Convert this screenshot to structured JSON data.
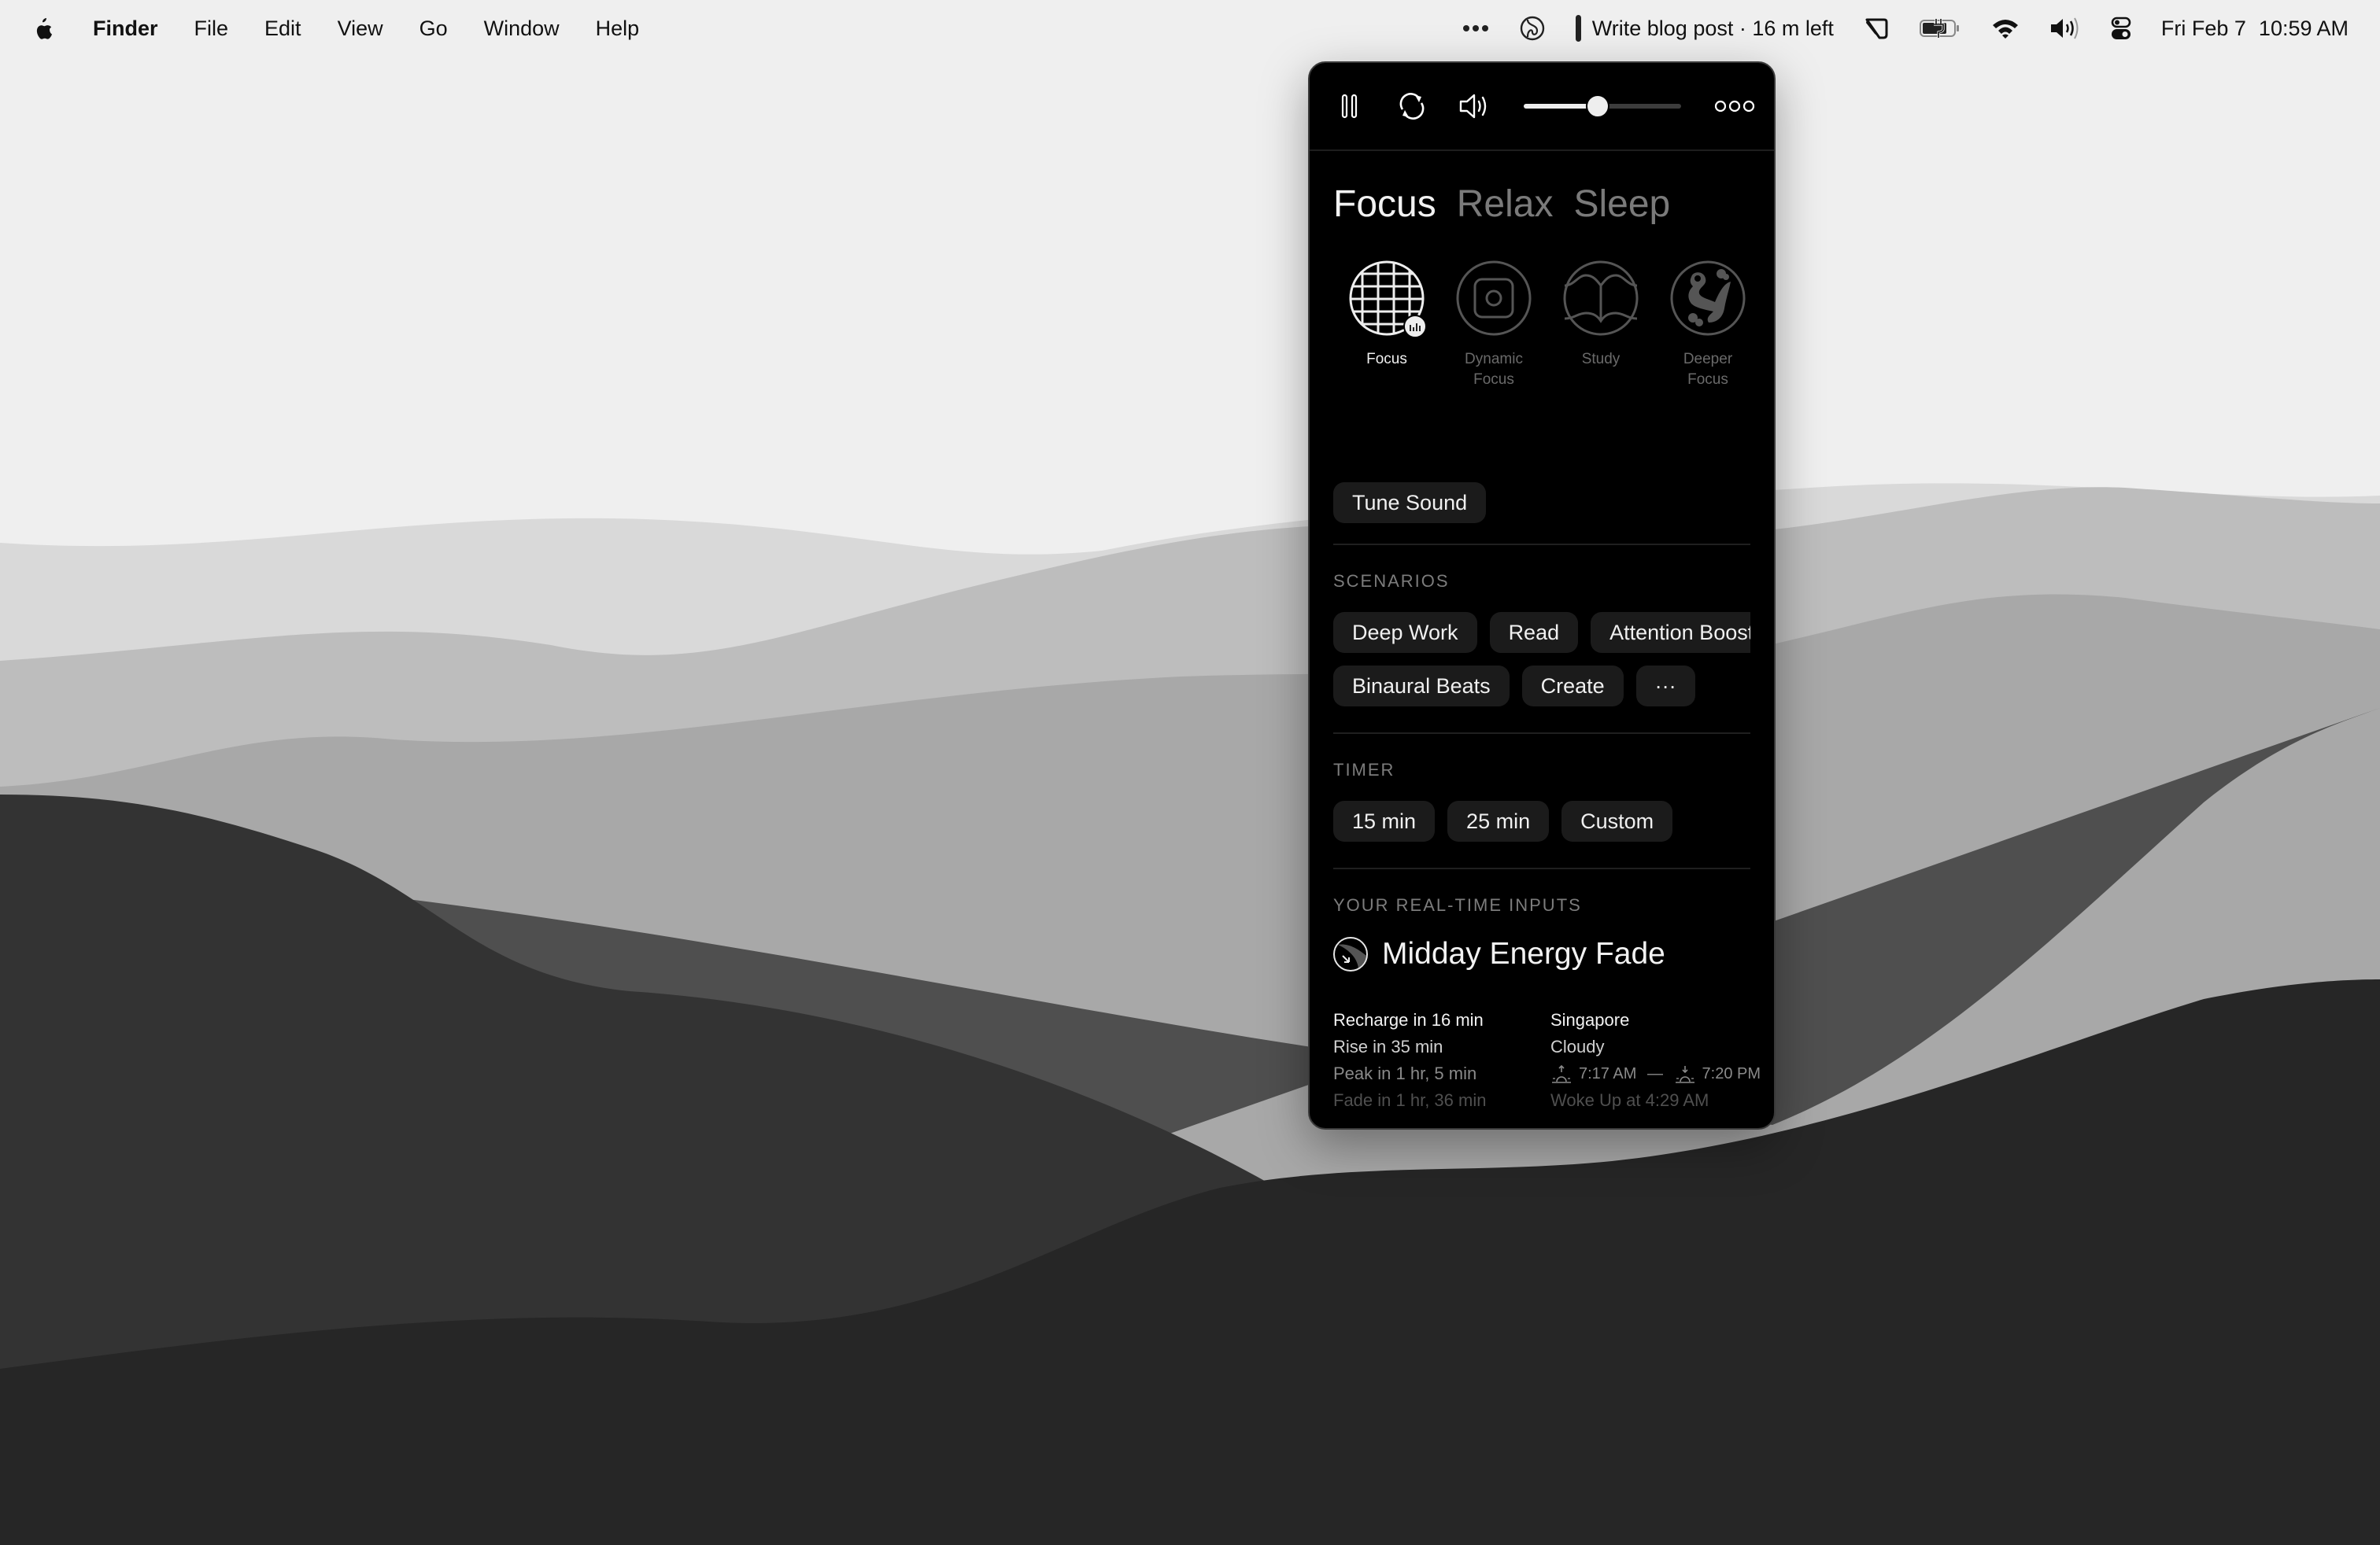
{
  "menubar": {
    "apple_icon": "apple-logo-icon",
    "app_name": "Finder",
    "menus": [
      "File",
      "Edit",
      "View",
      "Go",
      "Window",
      "Help"
    ],
    "status": {
      "overflow_icon": "ellipsis-icon",
      "app_icon": "endel-icon",
      "task_text": "Write blog post · 16 m left",
      "icons": [
        "display-brightness-icon",
        "battery-charging-icon",
        "wifi-icon",
        "volume-icon",
        "control-center-icon"
      ],
      "date": "Fri Feb 7",
      "time": "10:59 AM"
    }
  },
  "panel": {
    "toolbar": {
      "pause_icon": "pause-icon",
      "repeat_icon": "refresh-icon",
      "volume_icon": "speaker-icon",
      "volume_level": 0.47,
      "more_icon": "more-options-icon"
    },
    "tabs": [
      {
        "label": "Focus",
        "active": true
      },
      {
        "label": "Relax",
        "active": false
      },
      {
        "label": "Sleep",
        "active": false
      }
    ],
    "modes": [
      {
        "line1": "Focus",
        "line2": "",
        "icon": "grid-globe-icon",
        "active": true
      },
      {
        "line1": "Dynamic",
        "line2": "Focus",
        "icon": "square-dot-icon",
        "active": false
      },
      {
        "line1": "Study",
        "line2": "",
        "icon": "open-book-icon",
        "active": false
      },
      {
        "line1": "Deeper",
        "line2": "Focus",
        "icon": "frog-icon",
        "active": false
      }
    ],
    "tune_sound": "Tune Sound",
    "scenarios": {
      "label": "SCENARIOS",
      "items": [
        "Deep Work",
        "Read",
        "Attention Boost",
        "Binaural Beats",
        "Create",
        "···"
      ]
    },
    "timer": {
      "label": "TIMER",
      "items": [
        "15 min",
        "25 min",
        "Custom"
      ]
    },
    "inputs": {
      "label": "YOUR REAL-TIME INPUTS",
      "state_title": "Midday Energy Fade",
      "left": [
        "Recharge in 16 min",
        "Rise in 35 min",
        "Peak in 1 hr, 5 min",
        "Fade in 1 hr, 36 min"
      ],
      "location": "Singapore",
      "weather": "Cloudy",
      "sunrise": "7:17 AM",
      "sunset": "7:20 PM",
      "dash": "—",
      "woke_up": "Woke Up at 4:29 AM"
    }
  },
  "colors": {
    "panel_bg": "#000000",
    "pill_bg": "#1b1b1b",
    "wallpaper": [
      "#efefef",
      "#d9d9d9",
      "#bdbdbd",
      "#a8a8a8",
      "#4f4f4f",
      "#333333",
      "#262626"
    ]
  }
}
